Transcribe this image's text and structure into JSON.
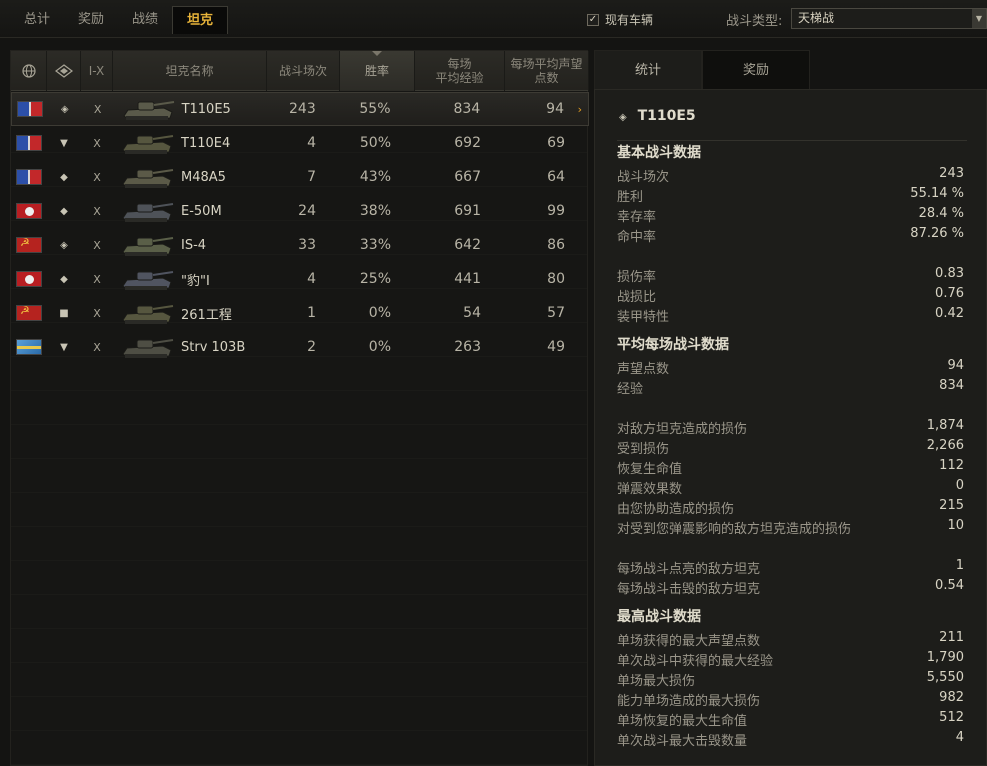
{
  "tabs": [
    "总计",
    "奖励",
    "战绩",
    "坦克"
  ],
  "active_tab": 3,
  "filter": {
    "label": "现有车辆",
    "checked": true,
    "check_glyph": "✓"
  },
  "battle_type": {
    "label": "战斗类型:",
    "value": "天梯战",
    "arrow_glyph": "▼"
  },
  "table": {
    "header": {
      "nation_icon": "globe-icon",
      "type_icon": "vehicle-type-icon",
      "tier": "I-X",
      "name": "坦克名称",
      "battles": "战斗场次",
      "winrate": "胜率",
      "avg_exp": "每场\n平均经验",
      "avg_rep": "每场平均声望\n点数"
    },
    "rows": [
      {
        "nation": "usa",
        "class_icon": "heavy-tank-icon",
        "class_glyph": "◈",
        "tier": "X",
        "name": "T110E5",
        "battles": "243",
        "winrate": "55%",
        "exp": "834",
        "rep": "94",
        "selected": true
      },
      {
        "nation": "usa",
        "class_icon": "td-icon",
        "class_glyph": "▼",
        "tier": "X",
        "name": "T110E4",
        "battles": "4",
        "winrate": "50%",
        "exp": "692",
        "rep": "69"
      },
      {
        "nation": "usa",
        "class_icon": "medium-tank-icon",
        "class_glyph": "◆",
        "tier": "X",
        "name": "M48A5",
        "battles": "7",
        "winrate": "43%",
        "exp": "667",
        "rep": "64"
      },
      {
        "nation": "ger",
        "class_icon": "heavy-tank-icon",
        "class_glyph": "◆",
        "tier": "X",
        "name": "E-50M",
        "battles": "24",
        "winrate": "38%",
        "exp": "691",
        "rep": "99"
      },
      {
        "nation": "ussr",
        "class_icon": "heavy-tank-icon",
        "class_glyph": "◈",
        "tier": "X",
        "name": "IS-4",
        "battles": "33",
        "winrate": "33%",
        "exp": "642",
        "rep": "86"
      },
      {
        "nation": "ger",
        "class_icon": "medium-tank-icon",
        "class_glyph": "◆",
        "tier": "X",
        "name": "\"豹\"I",
        "battles": "4",
        "winrate": "25%",
        "exp": "441",
        "rep": "80"
      },
      {
        "nation": "ussr",
        "class_icon": "spg-icon",
        "class_glyph": "■",
        "tier": "X",
        "name": "261工程",
        "battles": "1",
        "winrate": "0%",
        "exp": "54",
        "rep": "57"
      },
      {
        "nation": "swe",
        "class_icon": "td-icon",
        "class_glyph": "▼",
        "tier": "X",
        "name": "Strv 103B",
        "battles": "2",
        "winrate": "0%",
        "exp": "263",
        "rep": "49"
      }
    ],
    "selected_arrow": "›"
  },
  "right": {
    "tabs": [
      "统计",
      "奖励"
    ],
    "vehicle": {
      "glyph": "◈",
      "name": "T110E5"
    },
    "sections": [
      {
        "title": "基本战斗数据",
        "groups": [
          [
            [
              "战斗场次",
              "243"
            ],
            [
              "胜利",
              "55.14 %"
            ],
            [
              "幸存率",
              "28.4 %"
            ],
            [
              "命中率",
              "87.26 %"
            ]
          ],
          [
            [
              "损伤率",
              "0.83"
            ],
            [
              "战损比",
              "0.76"
            ],
            [
              "装甲特性",
              "0.42"
            ]
          ]
        ]
      },
      {
        "title": "平均每场战斗数据",
        "groups": [
          [
            [
              "声望点数",
              "94"
            ],
            [
              "经验",
              "834"
            ]
          ],
          [
            [
              "对敌方坦克造成的损伤",
              "1,874"
            ],
            [
              "受到损伤",
              "2,266"
            ],
            [
              "恢复生命值",
              "112"
            ],
            [
              "弹震效果数",
              "0"
            ],
            [
              "由您协助造成的损伤",
              "215"
            ],
            [
              "对受到您弹震影响的敌方坦克造成的损伤",
              "10"
            ]
          ],
          [
            [
              "每场战斗点亮的敌方坦克",
              "1"
            ],
            [
              "每场战斗击毁的敌方坦克",
              "0.54"
            ]
          ]
        ]
      },
      {
        "title": "最高战斗数据",
        "groups": [
          [
            [
              "单场获得的最大声望点数",
              "211"
            ],
            [
              "单次战斗中获得的最大经验",
              "1,790"
            ],
            [
              "单场最大损伤",
              "5,550"
            ],
            [
              "能力单场造成的最大损伤",
              "982"
            ],
            [
              "单场恢复的最大生命值",
              "512"
            ],
            [
              "单次战斗最大击毁数量",
              "4"
            ]
          ]
        ]
      }
    ]
  }
}
